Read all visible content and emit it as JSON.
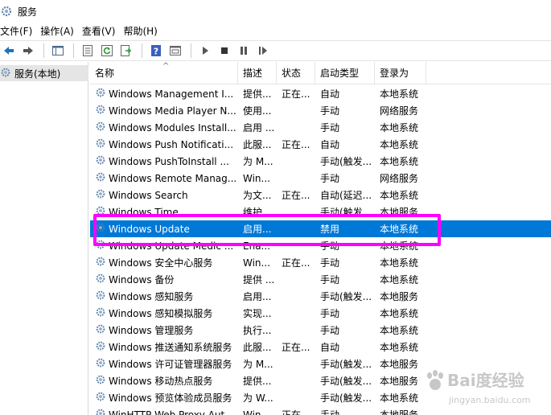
{
  "window": {
    "title": "服务"
  },
  "menu": {
    "items": [
      "文件(F)",
      "操作(A)",
      "查看(V)",
      "帮助(H)"
    ]
  },
  "toolbar": {
    "buttons": [
      "back-arrow-icon",
      "forward-arrow-icon",
      "show-hide-tree-icon",
      "properties-icon",
      "refresh-icon",
      "export-list-icon",
      "help-icon",
      "view-icon",
      "start-service-icon",
      "stop-service-icon",
      "pause-service-icon",
      "restart-service-icon"
    ]
  },
  "tree": {
    "item_label": "服务(本地)"
  },
  "table": {
    "columns": {
      "name": "名称",
      "description": "描述",
      "status": "状态",
      "startup": "启动类型",
      "logon": "登录为"
    },
    "rows": [
      {
        "name": "Windows Management I...",
        "description": "提供...",
        "status": "正在...",
        "startup": "自动",
        "logon": "本地系统"
      },
      {
        "name": "Windows Media Player N...",
        "description": "使用...",
        "status": "",
        "startup": "手动",
        "logon": "网络服务"
      },
      {
        "name": "Windows Modules Install...",
        "description": "启用 ...",
        "status": "",
        "startup": "手动",
        "logon": "本地系统"
      },
      {
        "name": "Windows Push Notificati...",
        "description": "此服...",
        "status": "正在...",
        "startup": "自动",
        "logon": "本地系统"
      },
      {
        "name": "Windows PushToInstall ...",
        "description": "为 M...",
        "status": "",
        "startup": "手动(触发...",
        "logon": "本地系统"
      },
      {
        "name": "Windows Remote Manag...",
        "description": "Win...",
        "status": "",
        "startup": "手动",
        "logon": "网络服务"
      },
      {
        "name": "Windows Search",
        "description": "为文...",
        "status": "正在...",
        "startup": "自动(延迟...",
        "logon": "本地系统"
      },
      {
        "name": "Windows Time",
        "description": "维护...",
        "status": "",
        "startup": "手动(触发...",
        "logon": "本地服务"
      },
      {
        "name": "Windows Update",
        "description": "启用...",
        "status": "",
        "startup": "禁用",
        "logon": "本地系统"
      },
      {
        "name": "Windows Update Medic ...",
        "description": "Ena...",
        "status": "",
        "startup": "手动",
        "logon": "本地系统"
      },
      {
        "name": "Windows 安全中心服务",
        "description": "Win...",
        "status": "正在...",
        "startup": "手动",
        "logon": "本地系统"
      },
      {
        "name": "Windows 备份",
        "description": "提供 ...",
        "status": "",
        "startup": "手动",
        "logon": "本地系统"
      },
      {
        "name": "Windows 感知服务",
        "description": "启用...",
        "status": "",
        "startup": "手动(触发...",
        "logon": "本地服务"
      },
      {
        "name": "Windows 感知模拟服务",
        "description": "实现...",
        "status": "",
        "startup": "手动",
        "logon": "本地系统"
      },
      {
        "name": "Windows 管理服务",
        "description": "执行...",
        "status": "",
        "startup": "手动",
        "logon": "本地系统"
      },
      {
        "name": "Windows 推送通知系统服务",
        "description": "此服...",
        "status": "正在...",
        "startup": "自动",
        "logon": "本地系统"
      },
      {
        "name": "Windows 许可证管理器服务",
        "description": "为 M...",
        "status": "",
        "startup": "手动(触发...",
        "logon": "本地服务"
      },
      {
        "name": "Windows 移动热点服务",
        "description": "提供...",
        "status": "",
        "startup": "手动(触发...",
        "logon": "本地服务"
      },
      {
        "name": "Windows 预览体验成员服务",
        "description": "为 W...",
        "status": "",
        "startup": "手动(触发...",
        "logon": "本地系统"
      },
      {
        "name": "WinHTTP Web Proxy Aut...",
        "description": "Win...",
        "status": "正在...",
        "startup": "手动",
        "logon": "本地服务"
      }
    ],
    "selected_index": 8
  },
  "colors": {
    "selection": "#0078d7",
    "highlight_box": "#ff00ff"
  },
  "watermark": {
    "text": "Bai度经验",
    "subtext": "jingyan.baidu.com"
  }
}
